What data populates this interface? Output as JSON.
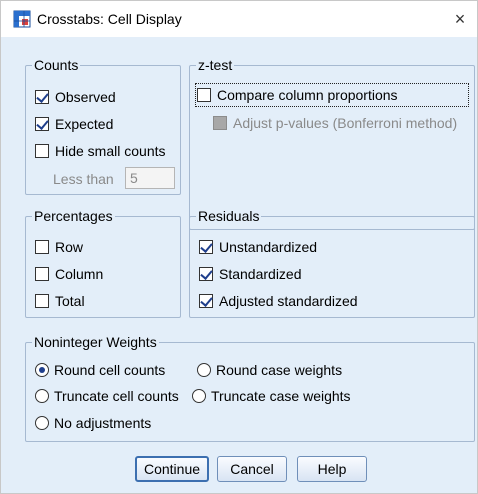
{
  "window": {
    "title": "Crosstabs: Cell Display",
    "close_glyph": "×",
    "icon": "crosstabs-app-icon"
  },
  "counts": {
    "legend": "Counts",
    "observed": {
      "label": "Observed",
      "checked": true
    },
    "expected": {
      "label": "Expected",
      "checked": true
    },
    "hide_small": {
      "label": "Hide small counts",
      "checked": false
    },
    "less_than_label": "Less than",
    "less_than_value": "5"
  },
  "ztest": {
    "legend": "z-test",
    "compare": {
      "label": "Compare column proportions",
      "checked": false
    },
    "adjust": {
      "label": "Adjust p-values (Bonferroni method)",
      "checked": false,
      "enabled": false
    }
  },
  "percentages": {
    "legend": "Percentages",
    "row": {
      "label": "Row",
      "checked": false
    },
    "column": {
      "label": "Column",
      "checked": false
    },
    "total": {
      "label": "Total",
      "checked": false
    }
  },
  "residuals": {
    "legend": "Residuals",
    "unstandardized": {
      "label": "Unstandardized",
      "checked": true
    },
    "standardized": {
      "label": "Standardized",
      "checked": true
    },
    "adjusted": {
      "label": "Adjusted standardized",
      "checked": true
    }
  },
  "weights": {
    "legend": "Noninteger Weights",
    "round_cell": {
      "label": "Round cell counts",
      "selected": true
    },
    "round_case": {
      "label": "Round case weights",
      "selected": false
    },
    "truncate_cell": {
      "label": "Truncate cell counts",
      "selected": false
    },
    "truncate_case": {
      "label": "Truncate case weights",
      "selected": false
    },
    "no_adjust": {
      "label": "No adjustments",
      "selected": false
    }
  },
  "buttons": {
    "continue": "Continue",
    "cancel": "Cancel",
    "help": "Help"
  },
  "colors": {
    "dialog_background": "#e3eef9",
    "group_border": "#a6b9d1",
    "check_mark": "#1f3f8c"
  }
}
